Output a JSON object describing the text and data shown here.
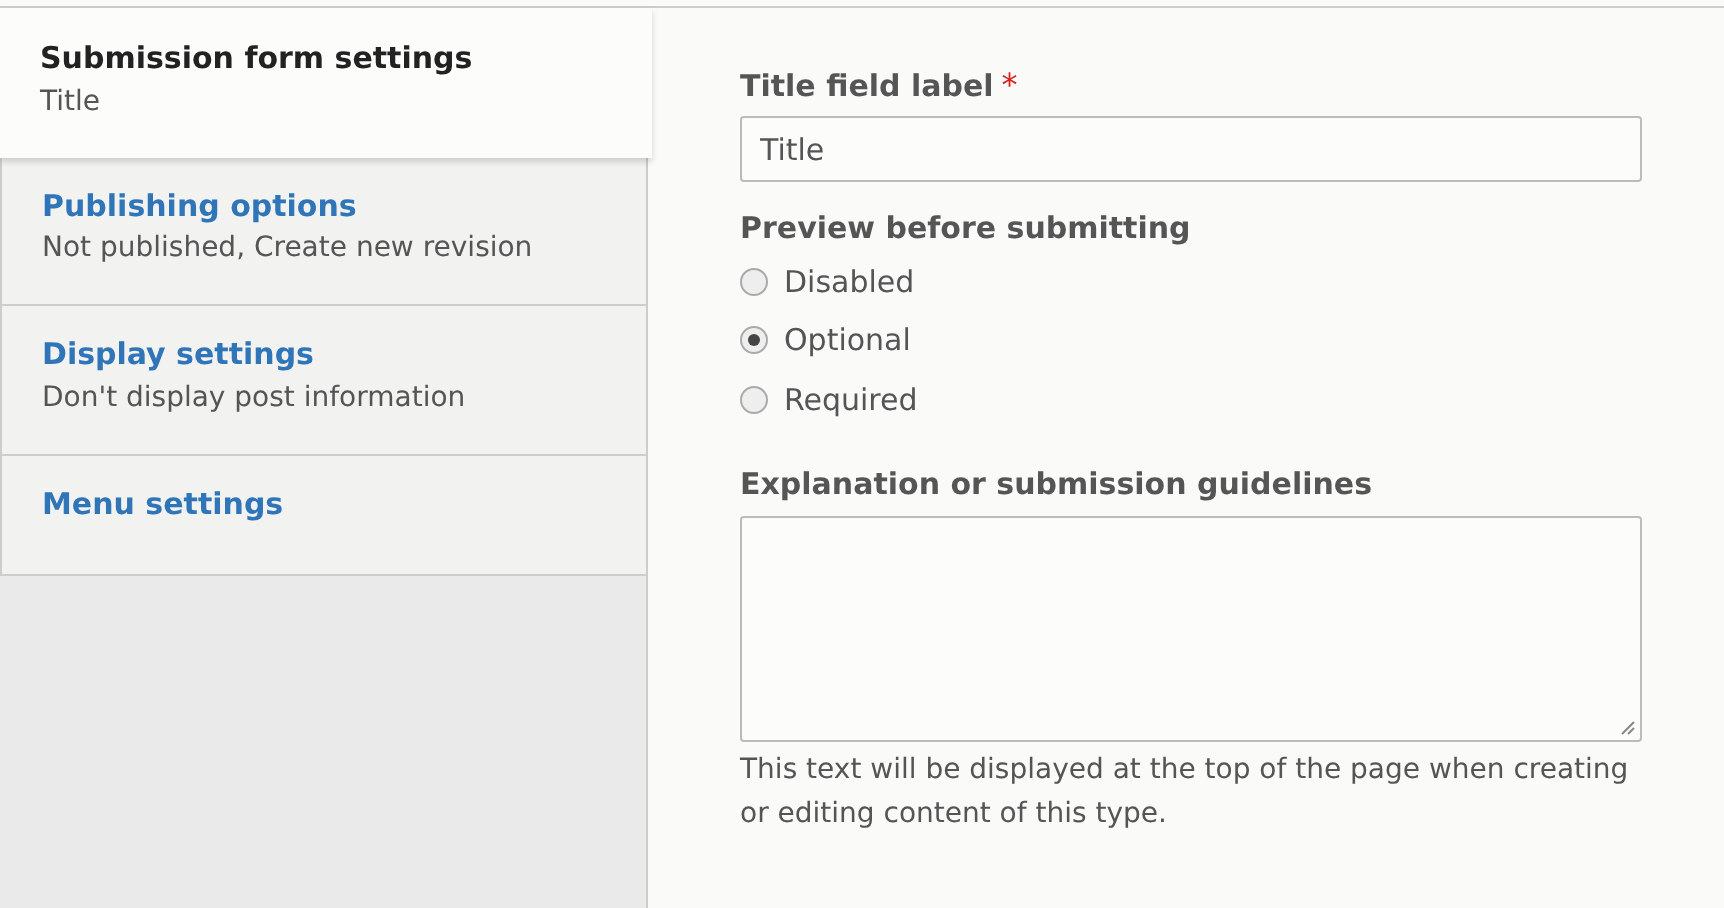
{
  "tabs": [
    {
      "title": "Submission form settings",
      "summary": "Title",
      "selected": true
    },
    {
      "title": "Publishing options",
      "summary": "Not published, Create new revision",
      "selected": false
    },
    {
      "title": "Display settings",
      "summary": "Don't display post information",
      "selected": false
    },
    {
      "title": "Menu settings",
      "selected": false
    }
  ],
  "title_field": {
    "label": "Title field label",
    "required_mark": "*",
    "value": "Title"
  },
  "preview": {
    "label": "Preview before submitting",
    "options": [
      {
        "label": "Disabled",
        "selected": false
      },
      {
        "label": "Optional",
        "selected": true
      },
      {
        "label": "Required",
        "selected": false
      }
    ]
  },
  "guidelines": {
    "label": "Explanation or submission guidelines",
    "description": "This text will be displayed at the top of the page when creating or editing content of this type."
  }
}
